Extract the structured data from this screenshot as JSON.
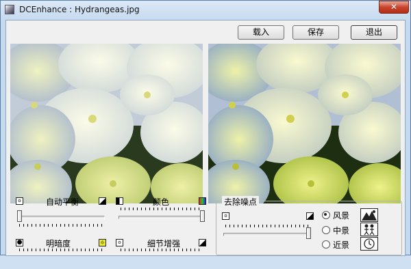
{
  "window": {
    "title": "DCEnhance : Hydrangeas.jpg",
    "close_label": "✕"
  },
  "toolbar": {
    "load_label": "载入",
    "save_label": "保存",
    "exit_label": "退出"
  },
  "adjust": {
    "auto_balance": {
      "label": "自动平衡",
      "level": 0.0
    },
    "color": {
      "label": "颜色",
      "level": 1.0
    },
    "brightness": {
      "label": "明暗度"
    },
    "detail": {
      "label": "细节增强"
    }
  },
  "denoise": {
    "label": "去除噪点",
    "level": 1.0,
    "modes": [
      {
        "label": "风景",
        "checked": true,
        "icon": "mountain-icon"
      },
      {
        "label": "中景",
        "checked": false,
        "icon": "people-icon"
      },
      {
        "label": "近景",
        "checked": false,
        "icon": "clock-icon"
      }
    ]
  },
  "colors": {
    "title_bg": "#dce9f7",
    "close": "#c9442c",
    "client_bg": "#f0f0f0"
  }
}
